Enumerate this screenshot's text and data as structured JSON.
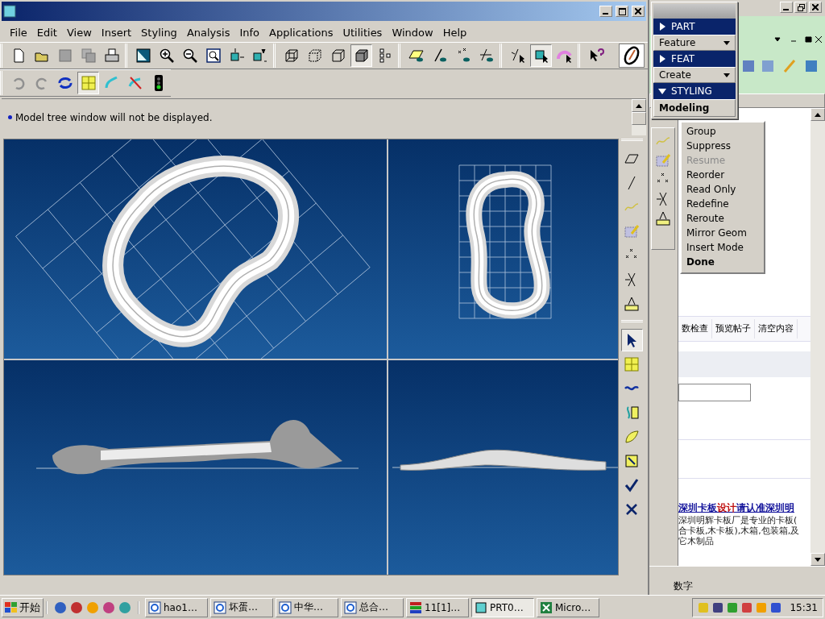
{
  "menu": [
    "File",
    "Edit",
    "View",
    "Insert",
    "Styling",
    "Analysis",
    "Info",
    "Applications",
    "Utilities",
    "Window",
    "Help"
  ],
  "toolbars": [
    {
      "groups": [
        [
          {
            "kind": "page",
            "pressed": false
          },
          {
            "kind": "folder",
            "pressed": false
          },
          {
            "kind": "floppy",
            "pressed": false
          },
          {
            "kind": "floppy-stack",
            "pressed": false
          },
          {
            "kind": "printer",
            "pressed": false
          }
        ],
        [
          {
            "kind": "display",
            "pressed": false
          },
          {
            "kind": "zoom-in",
            "pressed": false
          },
          {
            "kind": "zoom-out",
            "pressed": false
          },
          {
            "kind": "zoom-frame",
            "pressed": false
          },
          {
            "kind": "cube-arrows",
            "pressed": false
          },
          {
            "kind": "cube-text",
            "pressed": false
          }
        ],
        [
          {
            "kind": "box-wire",
            "pressed": false
          },
          {
            "kind": "box-dashed",
            "pressed": false
          },
          {
            "kind": "box-outline",
            "pressed": false
          },
          {
            "kind": "box-shaded",
            "pressed": true
          },
          {
            "kind": "tree-nodes",
            "pressed": false
          }
        ],
        [
          {
            "kind": "plane-eye",
            "pressed": false
          },
          {
            "kind": "axis-eye",
            "pressed": false
          },
          {
            "kind": "points-eye",
            "pressed": false
          },
          {
            "kind": "axes-eye",
            "pressed": false
          }
        ],
        [
          {
            "kind": "axes-cursor",
            "pressed": false
          },
          {
            "kind": "cube-cursor",
            "pressed": true
          },
          {
            "kind": "arc-cursor",
            "pressed": false
          }
        ],
        [
          {
            "kind": "question-cursor",
            "pressed": false
          }
        ]
      ]
    },
    {
      "groups": [
        [
          {
            "kind": "undo",
            "pressed": false
          },
          {
            "kind": "redo",
            "pressed": false
          },
          {
            "kind": "cycle",
            "pressed": false
          },
          {
            "kind": "grid",
            "pressed": true
          },
          {
            "kind": "curve",
            "pressed": false
          },
          {
            "kind": "curve-crossed",
            "pressed": false
          },
          {
            "kind": "traffic-light",
            "pressed": false
          }
        ]
      ]
    }
  ],
  "message": "Model tree window will not be displayed.",
  "side_toolbar": [
    [
      {
        "kind": "parallelogram",
        "pressed": false
      },
      {
        "kind": "line",
        "pressed": false
      },
      {
        "kind": "wave",
        "pressed": false
      },
      {
        "kind": "grid-pencil",
        "pressed": false
      },
      {
        "kind": "points",
        "pressed": false
      },
      {
        "kind": "axes",
        "pressed": false
      },
      {
        "kind": "ruler",
        "pressed": false
      }
    ],
    [
      {
        "kind": "arrow-cursor",
        "pressed": true
      },
      {
        "kind": "grid",
        "pressed": false
      },
      {
        "kind": "wave-blue",
        "pressed": false
      },
      {
        "kind": "curve-sheet",
        "pressed": false
      },
      {
        "kind": "surface",
        "pressed": false
      },
      {
        "kind": "sheet-arrow",
        "pressed": false
      },
      {
        "kind": "check",
        "pressed": false
      },
      {
        "kind": "cross",
        "pressed": false
      }
    ]
  ],
  "menu_manager": [
    {
      "kind": "header",
      "label": "PART",
      "expanded": false
    },
    {
      "kind": "dropdown",
      "label": "Feature"
    },
    {
      "kind": "header",
      "label": "FEAT",
      "expanded": false
    },
    {
      "kind": "dropdown",
      "label": "Create"
    },
    {
      "kind": "header",
      "label": "STYLING",
      "expanded": true
    },
    {
      "kind": "item",
      "label": "Modeling"
    }
  ],
  "feature_menu": [
    {
      "label": "Group",
      "disabled": false,
      "kind": "command"
    },
    {
      "label": "Suppress",
      "disabled": false,
      "kind": "command"
    },
    {
      "label": "Resume",
      "disabled": true,
      "kind": "command"
    },
    {
      "label": "Reorder",
      "disabled": false,
      "kind": "command"
    },
    {
      "label": "Read Only",
      "disabled": false,
      "kind": "command"
    },
    {
      "label": "Redefine",
      "disabled": false,
      "kind": "command"
    },
    {
      "label": "Reroute",
      "disabled": false,
      "kind": "command"
    },
    {
      "label": "Mirror Geom",
      "disabled": false,
      "kind": "command"
    },
    {
      "label": "Insert Mode",
      "disabled": false,
      "kind": "command"
    },
    {
      "label": "Done",
      "disabled": false,
      "kind": "done"
    }
  ],
  "browser": {
    "tabs": [
      "数检查",
      "预览帖子",
      "清空内容"
    ],
    "ad_title": [
      {
        "text": "深圳卡板",
        "highlight": false
      },
      {
        "text": "设计",
        "highlight": true
      },
      {
        "text": "请认准深圳明",
        "highlight": false
      }
    ],
    "ad_lines": [
      "深圳明辉卡板厂是专业的卡板(",
      "合卡板,木卡板),木箱,包装箱,及",
      "它木制品"
    ],
    "status": "数字"
  },
  "taskbar": {
    "start": "开始",
    "tasks": [
      {
        "label": "hao1…",
        "kind": "browser",
        "selected": false
      },
      {
        "label": "坏蛋…",
        "kind": "browser",
        "selected": false
      },
      {
        "label": "中华…",
        "kind": "browser",
        "selected": false
      },
      {
        "label": "总合…",
        "kind": "browser",
        "selected": false
      },
      {
        "label": "11[1]…",
        "kind": "archive",
        "selected": false
      },
      {
        "label": "PRT0…",
        "kind": "cad",
        "selected": true
      },
      {
        "label": "Micro…",
        "kind": "sheet",
        "selected": false
      }
    ],
    "clock": "15:31"
  }
}
